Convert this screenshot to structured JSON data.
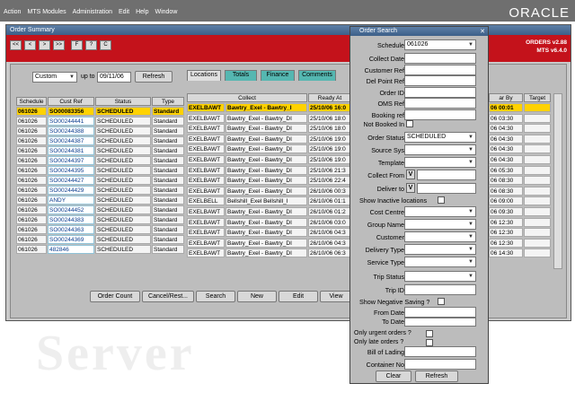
{
  "topbar": {
    "menus": [
      "Action",
      "MTS Modules",
      "Administration",
      "Edit",
      "Help",
      "Window"
    ],
    "brand": "ORACLE"
  },
  "order_window": {
    "title": "Order Summary",
    "toolbar": [
      "<<",
      "<",
      ">",
      ">>",
      "F",
      "?",
      "C"
    ],
    "version_lines": [
      "ORDERS v2.88",
      "MTS v6.4.0"
    ],
    "range_select": "Custom",
    "up_to_label": "up to",
    "up_to_value": "09/11/06",
    "refresh_label": "Refresh",
    "left_headers": [
      "Schedule",
      "Cust Ref",
      "Status",
      "Type"
    ],
    "left_rows": [
      [
        "061026",
        "SO00083356",
        "SCHEDULED",
        "Standard"
      ],
      [
        "061026",
        "SO00244441",
        "SCHEDULED",
        "Standard"
      ],
      [
        "061026",
        "SO00244388",
        "SCHEDULED",
        "Standard"
      ],
      [
        "061026",
        "SO00244387",
        "SCHEDULED",
        "Standard"
      ],
      [
        "061026",
        "SO00244381",
        "SCHEDULED",
        "Standard"
      ],
      [
        "061026",
        "SO00244397",
        "SCHEDULED",
        "Standard"
      ],
      [
        "061026",
        "SO00244395",
        "SCHEDULED",
        "Standard"
      ],
      [
        "061026",
        "SO00244427",
        "SCHEDULED",
        "Standard"
      ],
      [
        "061026",
        "SO00244429",
        "SCHEDULED",
        "Standard"
      ],
      [
        "061026",
        "ANDY",
        "SCHEDULED",
        "Standard"
      ],
      [
        "061026",
        "SO00244452",
        "SCHEDULED",
        "Standard"
      ],
      [
        "061026",
        "SO00244383",
        "SCHEDULED",
        "Standard"
      ],
      [
        "061026",
        "SO00244363",
        "SCHEDULED",
        "Standard"
      ],
      [
        "061026",
        "SO00244369",
        "SCHEDULED",
        "Standard"
      ],
      [
        "061026",
        "482846",
        "SCHEDULED",
        "Standard"
      ]
    ],
    "tabs": [
      "Locations",
      "Totals",
      "Finance",
      "Comments"
    ],
    "mid_headers": [
      "Collect",
      "Ready At"
    ],
    "mid_rows": [
      [
        "EXELBAWT",
        "Bawtry_Exel - Bawtry_I",
        "25/10/06 16:0"
      ],
      [
        "EXELBAWT",
        "Bawtry_Exel - Bawtry_DI",
        "25/10/06 18:0"
      ],
      [
        "EXELBAWT",
        "Bawtry_Exel - Bawtry_DI",
        "25/10/06 18:0"
      ],
      [
        "EXELBAWT",
        "Bawtry_Exel - Bawtry_DI",
        "25/10/06 19:0"
      ],
      [
        "EXELBAWT",
        "Bawtry_Exel - Bawtry_DI",
        "25/10/06 19:0"
      ],
      [
        "EXELBAWT",
        "Bawtry_Exel - Bawtry_DI",
        "25/10/06 19:0"
      ],
      [
        "EXELBAWT",
        "Bawtry_Exel - Bawtry_DI",
        "25/10/06 21:3"
      ],
      [
        "EXELBAWT",
        "Bawtry_Exel - Bawtry_DI",
        "25/10/06 22:4"
      ],
      [
        "EXELBAWT",
        "Bawtry_Exel - Bawtry_DI",
        "26/10/06 00:3"
      ],
      [
        "EXELBELL",
        "Bellshill_Exel Bellshill_I",
        "26/10/06 01:1"
      ],
      [
        "EXELBAWT",
        "Bawtry_Exel - Bawtry_DI",
        "26/10/06 01:2"
      ],
      [
        "EXELBAWT",
        "Bawtry_Exel - Bawtry_DI",
        "26/10/06 03:0"
      ],
      [
        "EXELBAWT",
        "Bawtry_Exel - Bawtry_DI",
        "26/10/06 04:3"
      ],
      [
        "EXELBAWT",
        "Bawtry_Exel - Bawtry_DI",
        "26/10/06 04:3"
      ],
      [
        "EXELBAWT",
        "Bawtry_Exel - Bawtry_DI",
        "26/10/06 06:3"
      ]
    ],
    "right_headers": [
      "ar By",
      "Target"
    ],
    "right_rows": [
      "06 00:01",
      "06 03:30",
      "06 04:30",
      "06 04:30",
      "06 04:30",
      "06 04:30",
      "06 05:30",
      "06 08:30",
      "06 08:30",
      "06 09:00",
      "06 09:30",
      "06 12:30",
      "06 12:30",
      "06 12:30",
      "06 14:30"
    ],
    "bottom_buttons": [
      "Order Count",
      "Cancel/Rest...",
      "Search",
      "New",
      "Edit",
      "View"
    ]
  },
  "dialog": {
    "title": "Order Search",
    "schedule_label": "Schedule",
    "schedule_value": "061026",
    "text_fields": [
      "Collect Date",
      "Customer Ref",
      "Del Point Ref",
      "Order ID",
      "OMS Ref",
      "Booking ref"
    ],
    "not_booked_label": "Not Booked In",
    "order_status_label": "Order Status",
    "order_status_value": "SCHEDULED",
    "source_sys_label": "Source Sys",
    "template_label": "Template",
    "collect_from_label": "Collect From",
    "deliver_to_label": "Deliver to",
    "v_label": "V",
    "show_inactive_label": "Show Inactive locations",
    "cost_centre_label": "Cost Centre",
    "group_name_label": "Group Name",
    "customer_label": "Customer",
    "delivery_type_label": "Delivery Type",
    "service_type_label": "Service Type",
    "trip_status_label": "Trip Status",
    "trip_id_label": "Trip ID",
    "show_negative_label": "Show Negative Saving ?",
    "from_date_label": "From Date",
    "to_date_label": "To Date",
    "urgent_label": "Only urgent orders ?",
    "late_label": "Only late orders ?",
    "bill_label": "Bill of Lading",
    "container_label": "Container No",
    "clear_label": "Clear",
    "refresh_label": "Refresh"
  },
  "watermark": "Server",
  "colors": {
    "accent_red": "#c4121b",
    "highlight": "#ffd200",
    "title_blue": "#3c5f88"
  }
}
